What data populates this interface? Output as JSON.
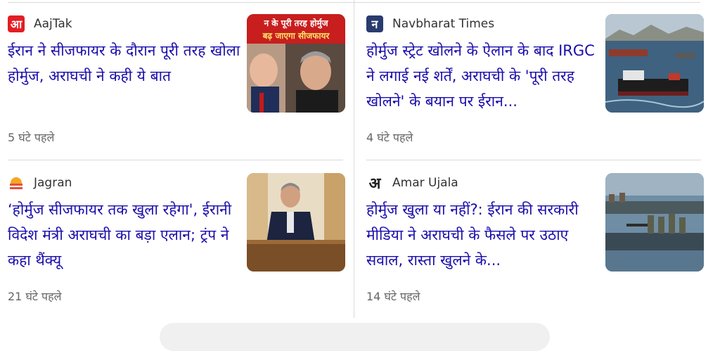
{
  "cards": [
    {
      "source": "AajTak",
      "logo_text": "आ",
      "logo_color": "#e31e24",
      "headline": "ईरान ने सीजफायर के दौरान पूरी तरह खोला होर्मुज, अराघची ने कही ये बात",
      "time": "5 घंटे पहले",
      "thumb_caption": "न के पूरी तरह होर्मुज बढ़ जाएगा सीजफायर"
    },
    {
      "source": "Navbharat Times",
      "logo_text": "न",
      "logo_color": "#2a3b6e",
      "headline": "होर्मुज स्ट्रेट खोलने के ऐलान के बाद IRGC ने लगाई नई शर्तें, अराघची के 'पूरी तरह खोलने' के बयान पर ईरान...",
      "time": "4 घंटे पहले"
    },
    {
      "source": "Jagran",
      "logo_text": "",
      "logo_color": "#f5a623",
      "headline": "‘होर्मुज सीजफायर तक खुला रहेगा', ईरानी विदेश मंत्री अराघची का बड़ा एलान; ट्रंप ने कहा थैंक्यू",
      "time": "21 घंटे पहले"
    },
    {
      "source": "Amar Ujala",
      "logo_text": "अ",
      "logo_color": "#222222",
      "headline": "होर्मुज खुला या नहीं?: ईरान की सरकारी मीडिया ने अराघची के फैसले पर उठाए सवाल, रास्ता खुलने के...",
      "time": "14 घंटे पहले"
    }
  ]
}
